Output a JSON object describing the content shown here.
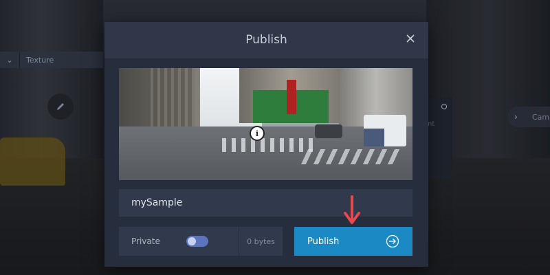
{
  "background": {
    "texture_panel": {
      "label": "Texture"
    },
    "right_panel": {
      "text": "nt"
    },
    "camera_button": {
      "label": "Cam"
    }
  },
  "modal": {
    "title": "Publish",
    "name_input": {
      "value": "mySample",
      "placeholder": ""
    },
    "privacy": {
      "label": "Private",
      "enabled": true
    },
    "size": "0 bytes",
    "publish_button": {
      "label": "Publish"
    }
  },
  "colors": {
    "accent": "#1b89c4",
    "modal_bg": "#262d3d",
    "field_bg": "#313a4d",
    "annotation_arrow": "#e5484d"
  },
  "icons": {
    "close": "close-icon",
    "publish": "arrow-right-circle-icon",
    "pencil": "pencil-icon",
    "info": "info-icon"
  }
}
